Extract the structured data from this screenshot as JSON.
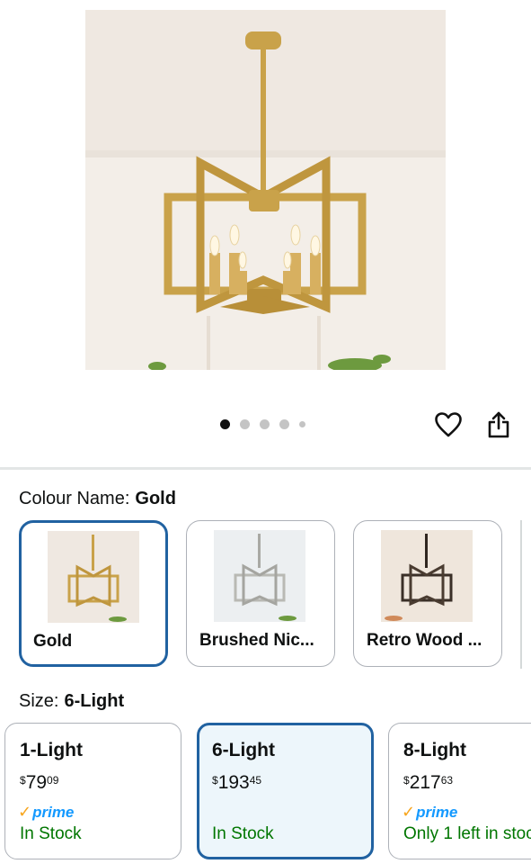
{
  "gallery": {
    "dot_count": 5,
    "active_index": 0
  },
  "actions": {
    "favorite_icon": "heart-icon",
    "share_icon": "share-icon"
  },
  "colour": {
    "label": "Colour Name:",
    "selected": "Gold",
    "options": [
      {
        "name": "Gold",
        "finish": "#c9a24a"
      },
      {
        "name": "Brushed Nic...",
        "finish": "#b9b9b4"
      },
      {
        "name": "Retro Wood ...",
        "finish": "#3a2f27"
      }
    ]
  },
  "size": {
    "label": "Size:",
    "selected": "6-Light",
    "options": [
      {
        "title": "1-Light",
        "dollars": "79",
        "cents": "09",
        "prime": "prime",
        "stock": "In Stock"
      },
      {
        "title": "6-Light",
        "dollars": "193",
        "cents": "45",
        "prime": "",
        "stock": "In Stock"
      },
      {
        "title": "8-Light",
        "dollars": "217",
        "cents": "63",
        "prime": "prime",
        "stock": "Only 1 left in stoc"
      }
    ]
  },
  "colors": {
    "accent_selected": "#2162a1",
    "in_stock": "#007600",
    "prime_blue": "#1399ff",
    "prime_check": "#f7a51d"
  }
}
